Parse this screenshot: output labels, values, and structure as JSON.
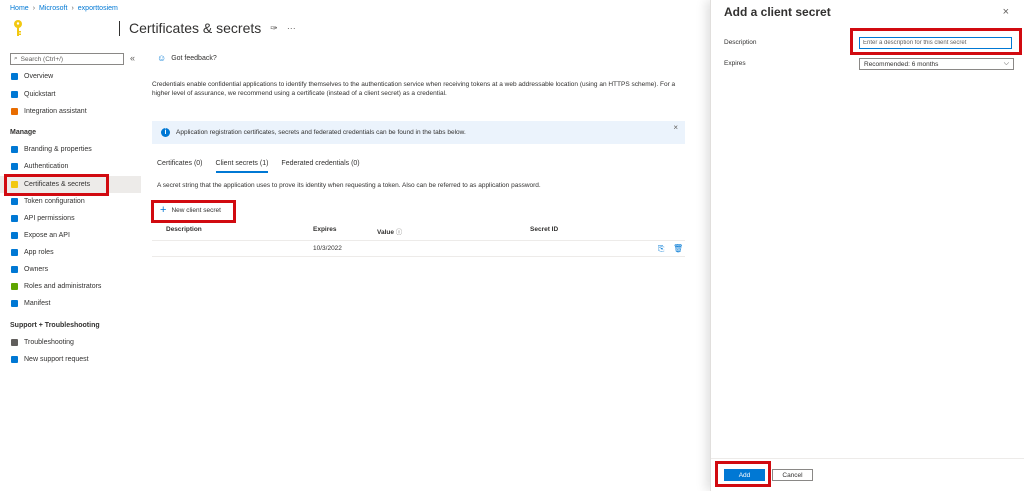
{
  "breadcrumb": [
    "Home",
    "Microsoft",
    "exporttosiem"
  ],
  "page": {
    "title": "Certificates & secrets",
    "pin_icon": "pin-icon",
    "more_label": "···"
  },
  "sidebar": {
    "search_placeholder": "Search (Ctrl+/)",
    "collapse_label": "«",
    "items": [
      {
        "label": "Overview",
        "icon": "overview-icon",
        "color": "#0078d4"
      },
      {
        "label": "Quickstart",
        "icon": "cloud-icon",
        "color": "#0078d4"
      },
      {
        "label": "Integration assistant",
        "icon": "rocket-icon",
        "color": "#e86c00"
      },
      {
        "label": "Branding & properties",
        "icon": "branding-icon",
        "color": "#0078d4"
      },
      {
        "label": "Authentication",
        "icon": "auth-icon",
        "color": "#0078d4"
      },
      {
        "label": "Certificates & secrets",
        "icon": "key-icon",
        "color": "#f2c811"
      },
      {
        "label": "Token configuration",
        "icon": "token-icon",
        "color": "#0078d4"
      },
      {
        "label": "API permissions",
        "icon": "permissions-icon",
        "color": "#0078d4"
      },
      {
        "label": "Expose an API",
        "icon": "expose-api-icon",
        "color": "#0078d4"
      },
      {
        "label": "App roles",
        "icon": "app-roles-icon",
        "color": "#0078d4"
      },
      {
        "label": "Owners",
        "icon": "owners-icon",
        "color": "#0078d4"
      },
      {
        "label": "Roles and administrators",
        "icon": "roles-icon",
        "color": "#5ea500"
      },
      {
        "label": "Manifest",
        "icon": "manifest-icon",
        "color": "#0078d4"
      },
      {
        "label": "Troubleshooting",
        "icon": "wrench-icon",
        "color": "#605e5c"
      },
      {
        "label": "New support request",
        "icon": "support-icon",
        "color": "#0078d4"
      }
    ],
    "sections": {
      "manage": "Manage",
      "support": "Support + Troubleshooting"
    }
  },
  "main": {
    "feedback_label": "Got feedback?",
    "description": "Credentials enable confidential applications to identify themselves to the authentication service when receiving tokens at a web addressable location (using an HTTPS scheme). For a higher level of assurance, we recommend using a certificate (instead of a client secret) as a credential.",
    "info_text": "Application registration certificates, secrets and federated credentials can be found in the tabs below.",
    "tabs": [
      {
        "label": "Certificates (0)"
      },
      {
        "label": "Client secrets (1)"
      },
      {
        "label": "Federated credentials (0)"
      }
    ],
    "tab_note": "A secret string that the application uses to prove its identity when requesting a token. Also can be referred to as application password.",
    "new_secret_label": "New client secret",
    "columns": [
      "Description",
      "Expires",
      "Value",
      "Secret ID"
    ],
    "rows": [
      {
        "description": "",
        "expires": "10/3/2022",
        "value": "",
        "secret_id": ""
      }
    ]
  },
  "panel": {
    "title": "Add a client secret",
    "close_label": "×",
    "description_label": "Description",
    "description_placeholder": "Enter a description for this client secret",
    "expires_label": "Expires",
    "expires_value": "Recommended: 6 months",
    "add_label": "Add",
    "cancel_label": "Cancel"
  },
  "colors": {
    "accent": "#0078d4",
    "highlight": "#d10a10",
    "key": "#f2c811"
  }
}
